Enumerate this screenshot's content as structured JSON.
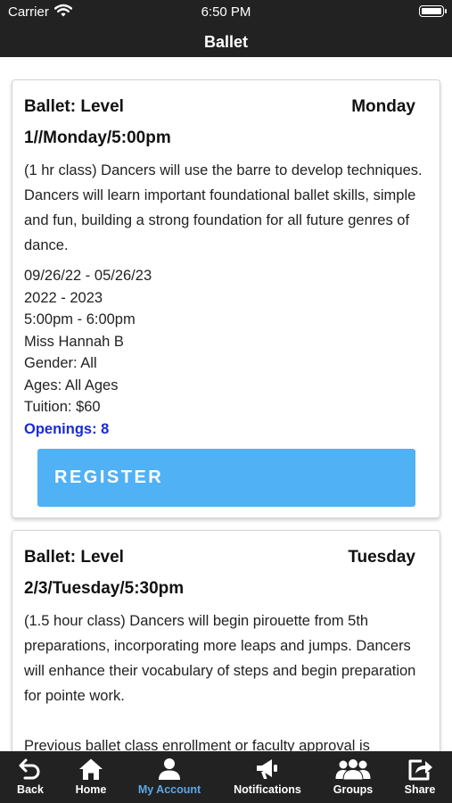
{
  "status_bar": {
    "carrier": "Carrier",
    "time": "6:50 PM"
  },
  "nav": {
    "title": "Ballet"
  },
  "classes": [
    {
      "title": "Ballet: Level",
      "day": "Monday",
      "subtitle": "1//Monday/5:00pm",
      "description": "(1 hr class) Dancers will use the barre to develop techniques. Dancers will learn important foundational ballet skills, simple and fun, building a strong foundation for all future genres of dance.",
      "dates": "09/26/22 - 05/26/23",
      "season": "2022 - 2023",
      "time": "5:00pm - 6:00pm",
      "instructor": "Miss Hannah B",
      "gender": "Gender: All",
      "ages": "Ages: All Ages",
      "tuition": "Tuition: $60",
      "openings": "Openings: 8",
      "register_label": "REGISTER"
    },
    {
      "title": "Ballet: Level",
      "day": "Tuesday",
      "subtitle": "2/3/Tuesday/5:30pm",
      "description": "(1.5 hour class) Dancers will begin pirouette from 5th preparations, incorporating more leaps and jumps. Dancers will enhance their vocabulary of steps and begin preparation for pointe work.",
      "note": "Previous ballet class enrollment or faculty approval is"
    }
  ],
  "tabs": [
    {
      "label": "Back",
      "icon": "back-arrow-icon",
      "active": false
    },
    {
      "label": "Home",
      "icon": "home-icon",
      "active": false
    },
    {
      "label": "My Account",
      "icon": "person-icon",
      "active": true
    },
    {
      "label": "Notifications",
      "icon": "megaphone-icon",
      "active": false
    },
    {
      "label": "Groups",
      "icon": "group-icon",
      "active": false
    },
    {
      "label": "Share",
      "icon": "share-icon",
      "active": false
    }
  ],
  "colors": {
    "bar_background": "#222222",
    "active_tab": "#5aa8e8",
    "register_button": "#51b1f5",
    "openings_text": "#1a2bd6"
  }
}
